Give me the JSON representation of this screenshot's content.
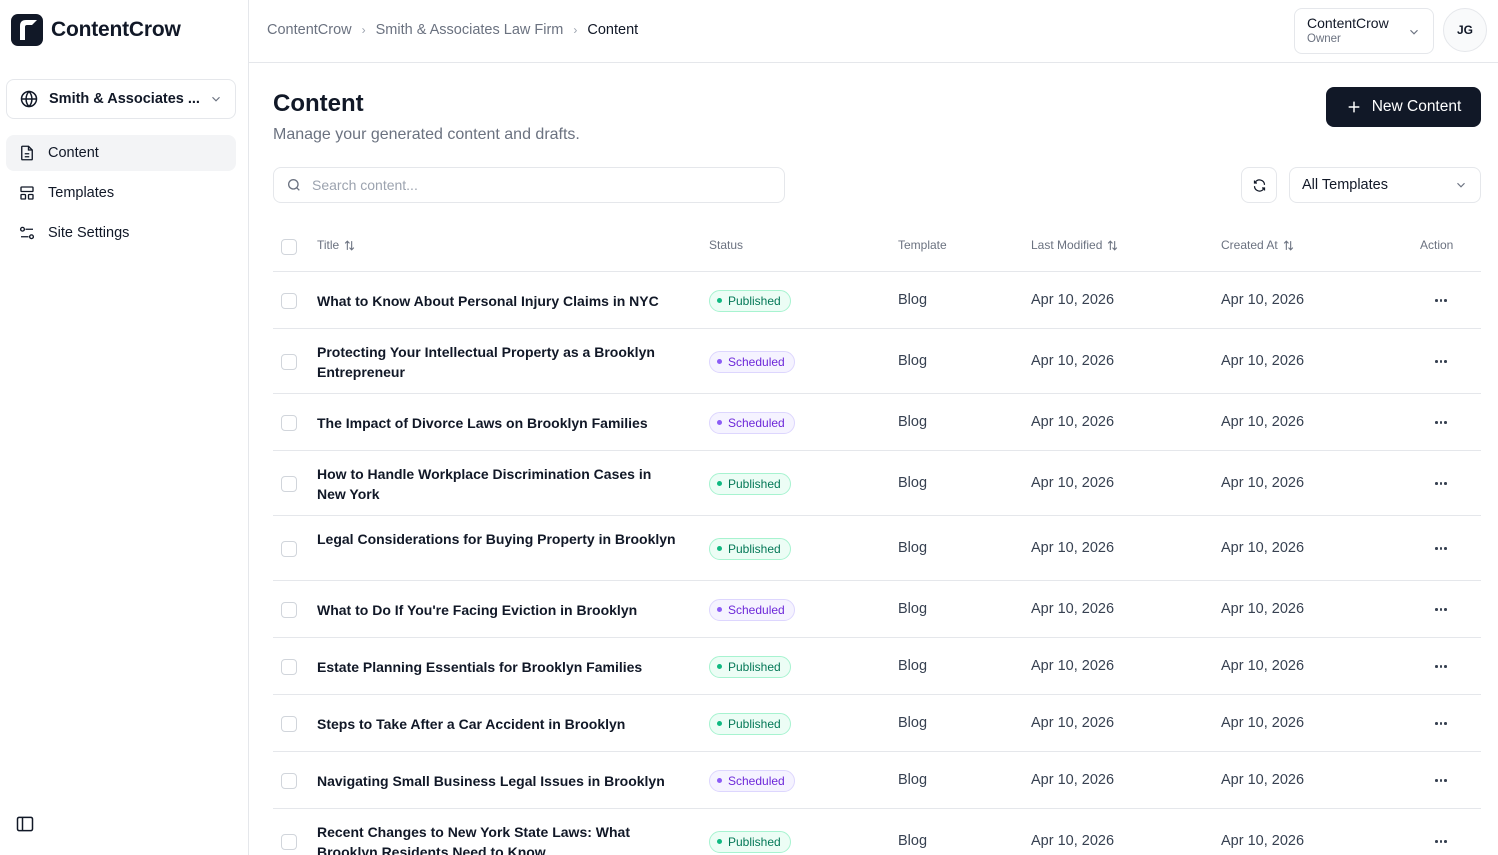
{
  "brand": {
    "name": "ContentCrow"
  },
  "sidebar": {
    "site_selector": "Smith & Associates ...",
    "items": [
      {
        "label": "Content",
        "icon": "document-icon",
        "active": true
      },
      {
        "label": "Templates",
        "icon": "layout-icon",
        "active": false
      },
      {
        "label": "Site Settings",
        "icon": "sliders-icon",
        "active": false
      }
    ]
  },
  "breadcrumb": [
    "ContentCrow",
    "Smith & Associates Law Firm",
    "Content"
  ],
  "account": {
    "name": "ContentCrow",
    "role": "Owner",
    "initials": "JG"
  },
  "main": {
    "title": "Content",
    "subtitle": "Manage your generated content and drafts.",
    "new_button": "New Content",
    "search_placeholder": "Search content...",
    "template_filter": "All Templates"
  },
  "table": {
    "columns": {
      "title": "Title",
      "status": "Status",
      "template": "Template",
      "modified": "Last Modified",
      "created": "Created At",
      "action": "Action"
    },
    "rows": [
      {
        "title": "What to Know About Personal Injury Claims in NYC",
        "status": "Published",
        "template": "Blog",
        "modified": "Apr 10, 2026",
        "created": "Apr 10, 2026"
      },
      {
        "title": "Protecting Your Intellectual Property as a Brooklyn Entrepreneur",
        "status": "Scheduled",
        "template": "Blog",
        "modified": "Apr 10, 2026",
        "created": "Apr 10, 2026"
      },
      {
        "title": "The Impact of Divorce Laws on Brooklyn Families",
        "status": "Scheduled",
        "template": "Blog",
        "modified": "Apr 10, 2026",
        "created": "Apr 10, 2026"
      },
      {
        "title": "How to Handle Workplace Discrimination Cases in New York",
        "status": "Published",
        "template": "Blog",
        "modified": "Apr 10, 2026",
        "created": "Apr 10, 2026"
      },
      {
        "title": "Legal Considerations for Buying Property in Brooklyn",
        "status": "Published",
        "template": "Blog",
        "modified": "Apr 10, 2026",
        "created": "Apr 10, 2026"
      },
      {
        "title": "What to Do If You're Facing Eviction in Brooklyn",
        "status": "Scheduled",
        "template": "Blog",
        "modified": "Apr 10, 2026",
        "created": "Apr 10, 2026"
      },
      {
        "title": "Estate Planning Essentials for Brooklyn Families",
        "status": "Published",
        "template": "Blog",
        "modified": "Apr 10, 2026",
        "created": "Apr 10, 2026"
      },
      {
        "title": "Steps to Take After a Car Accident in Brooklyn",
        "status": "Published",
        "template": "Blog",
        "modified": "Apr 10, 2026",
        "created": "Apr 10, 2026"
      },
      {
        "title": "Navigating Small Business Legal Issues in Brooklyn",
        "status": "Scheduled",
        "template": "Blog",
        "modified": "Apr 10, 2026",
        "created": "Apr 10, 2026"
      },
      {
        "title": "Recent Changes to New York State Laws: What Brooklyn Residents Need to Know",
        "status": "Published",
        "template": "Blog",
        "modified": "Apr 10, 2026",
        "created": "Apr 10, 2026"
      }
    ]
  }
}
